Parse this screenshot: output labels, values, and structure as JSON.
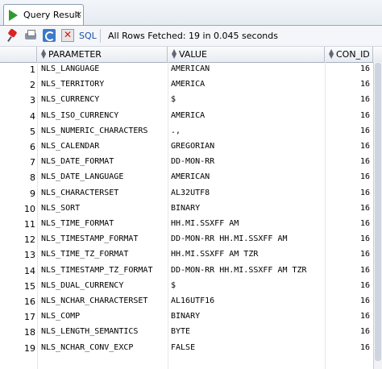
{
  "tab": {
    "label": "Query Result",
    "close": "×"
  },
  "toolbar": {
    "sql_label": "SQL",
    "status": "All Rows Fetched: 19 in 0.045 seconds"
  },
  "columns": [
    "PARAMETER",
    "VALUE",
    "CON_ID"
  ],
  "rows": [
    {
      "n": "1",
      "param": "NLS_LANGUAGE",
      "value": "AMERICAN",
      "con": "16"
    },
    {
      "n": "2",
      "param": "NLS_TERRITORY",
      "value": "AMERICA",
      "con": "16"
    },
    {
      "n": "3",
      "param": "NLS_CURRENCY",
      "value": "$",
      "con": "16"
    },
    {
      "n": "4",
      "param": "NLS_ISO_CURRENCY",
      "value": "AMERICA",
      "con": "16"
    },
    {
      "n": "5",
      "param": "NLS_NUMERIC_CHARACTERS",
      "value": ".,",
      "con": "16"
    },
    {
      "n": "6",
      "param": "NLS_CALENDAR",
      "value": "GREGORIAN",
      "con": "16"
    },
    {
      "n": "7",
      "param": "NLS_DATE_FORMAT",
      "value": "DD-MON-RR",
      "con": "16"
    },
    {
      "n": "8",
      "param": "NLS_DATE_LANGUAGE",
      "value": "AMERICAN",
      "con": "16"
    },
    {
      "n": "9",
      "param": "NLS_CHARACTERSET",
      "value": "AL32UTF8",
      "con": "16"
    },
    {
      "n": "10",
      "param": "NLS_SORT",
      "value": "BINARY",
      "con": "16"
    },
    {
      "n": "11",
      "param": "NLS_TIME_FORMAT",
      "value": "HH.MI.SSXFF AM",
      "con": "16"
    },
    {
      "n": "12",
      "param": "NLS_TIMESTAMP_FORMAT",
      "value": "DD-MON-RR HH.MI.SSXFF AM",
      "con": "16"
    },
    {
      "n": "13",
      "param": "NLS_TIME_TZ_FORMAT",
      "value": "HH.MI.SSXFF AM TZR",
      "con": "16"
    },
    {
      "n": "14",
      "param": "NLS_TIMESTAMP_TZ_FORMAT",
      "value": "DD-MON-RR HH.MI.SSXFF AM TZR",
      "con": "16"
    },
    {
      "n": "15",
      "param": "NLS_DUAL_CURRENCY",
      "value": "$",
      "con": "16"
    },
    {
      "n": "16",
      "param": "NLS_NCHAR_CHARACTERSET",
      "value": "AL16UTF16",
      "con": "16"
    },
    {
      "n": "17",
      "param": "NLS_COMP",
      "value": "BINARY",
      "con": "16"
    },
    {
      "n": "18",
      "param": "NLS_LENGTH_SEMANTICS",
      "value": "BYTE",
      "con": "16"
    },
    {
      "n": "19",
      "param": "NLS_NCHAR_CONV_EXCP",
      "value": "FALSE",
      "con": "16"
    }
  ]
}
